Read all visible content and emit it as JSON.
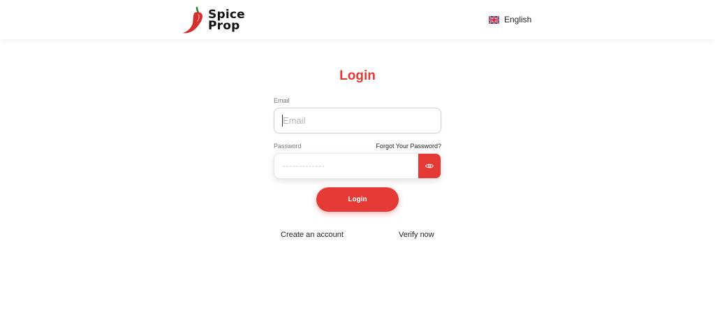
{
  "header": {
    "logo": {
      "line1": "Spice",
      "line2": "Prop",
      "icon": "chili-pepper-icon"
    },
    "language": {
      "label": "English",
      "icon": "uk-flag-icon"
    }
  },
  "form": {
    "title": "Login",
    "email": {
      "label": "Email",
      "placeholder": "Email",
      "value": ""
    },
    "password": {
      "label": "Password",
      "placeholder": "-------------",
      "forgot_label": "Forgot Your Password?",
      "toggle_icon": "eye-icon"
    },
    "submit_label": "Login"
  },
  "links": {
    "create_account": "Create an account",
    "verify_now": "Verify now"
  },
  "colors": {
    "accent": "#e53935",
    "text": "#222222",
    "label": "#777777"
  }
}
